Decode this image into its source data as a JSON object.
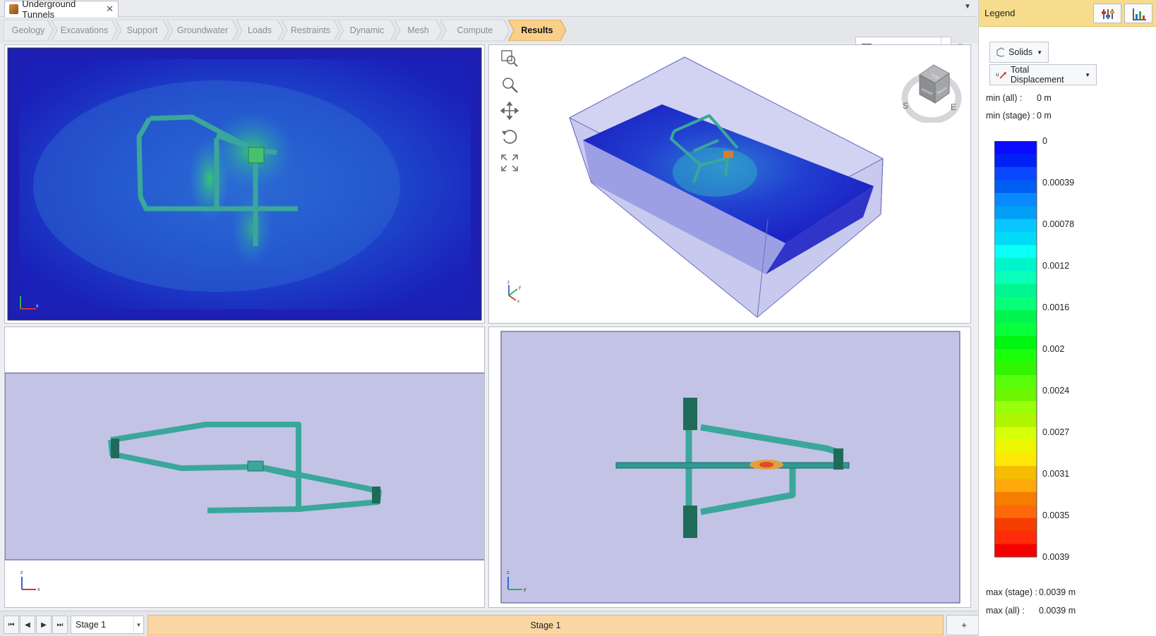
{
  "app": {
    "document_tab": "Underground Tunnels",
    "close_glyph": "✕",
    "tab_menu_glyph": "▼"
  },
  "workflow": {
    "steps": [
      "Geology",
      "Excavations",
      "Support",
      "Groundwater",
      "Loads",
      "Restraints",
      "Dynamic",
      "Mesh",
      "Compute",
      "Results"
    ],
    "active": "Results"
  },
  "view_layout": {
    "value": "2x2",
    "dropdown_glyph": "▼",
    "refresh_glyph": "⟳"
  },
  "viewport_tools": [
    "zoom-window-icon",
    "zoom-icon",
    "pan-icon",
    "rotate-icon",
    "zoom-extents-icon"
  ],
  "view_cube": {
    "south": "S",
    "east": "E",
    "top": "TOP",
    "front": "FRONT",
    "right": "RIGHT"
  },
  "axes": {
    "x": "x",
    "y": "y",
    "z": "z"
  },
  "legend": {
    "title": "Legend",
    "object_filter": "Solids",
    "result_type": "Total Displacement",
    "dropdown_glyph": "▼",
    "min_all_label": "min (all) :",
    "min_all_value": "0 m",
    "min_stage_label": "min (stage) :",
    "min_stage_value": "0 m",
    "max_stage_label": "max (stage) :",
    "max_stage_value": "0.0039 m",
    "max_all_label": "max (all) :",
    "max_all_value": "0.0039 m",
    "scale_labels": [
      "0",
      "0.00039",
      "0.00078",
      "0.0012",
      "0.0016",
      "0.002",
      "0.0024",
      "0.0027",
      "0.0031",
      "0.0035",
      "0.0039"
    ],
    "colors": {
      "low": "#0000ff",
      "mid": "#00e000",
      "high": "#ff0000"
    }
  },
  "stages": {
    "selected": "Stage 1",
    "tab": "Stage 1",
    "add_glyph": "+",
    "dropdown_glyph": "▼",
    "nav_glyphs": [
      "⏮",
      "◀",
      "▶",
      "⏭"
    ]
  }
}
